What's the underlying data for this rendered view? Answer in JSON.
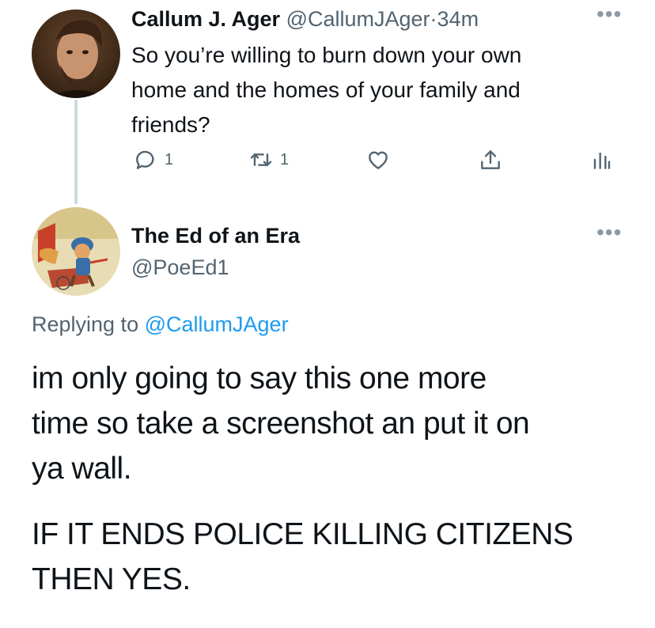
{
  "reply_tweet": {
    "author_name": "Callum J. Ager",
    "handle": "@CallumJAger",
    "separator": "·",
    "time": "34m",
    "text_lines": [
      "So you’re willing to burn down your own",
      "home and the homes of your family and",
      "friends?"
    ],
    "reply_count": "1",
    "retweet_count": "1"
  },
  "main_tweet": {
    "author_name": "The Ed of an Era",
    "handle": "@PoeEd1",
    "replying_prefix": "Replying to",
    "replying_to": "@CallumJAger",
    "body_lines": [
      "im only going to say this one more",
      "time so take a screenshot an put it on",
      "ya wall."
    ],
    "caps_lines": [
      "IF IT ENDS POLICE KILLING CITIZENS",
      "THEN YES."
    ]
  },
  "icons": {
    "more": "more-icon",
    "reply": "reply-icon",
    "retweet": "retweet-icon",
    "like": "heart-icon",
    "share": "share-icon",
    "analytics": "analytics-icon"
  },
  "colors": {
    "text": "#0f1419",
    "muted": "#536471",
    "link": "#1d9bf0",
    "thread_line": "#cfd9de"
  }
}
